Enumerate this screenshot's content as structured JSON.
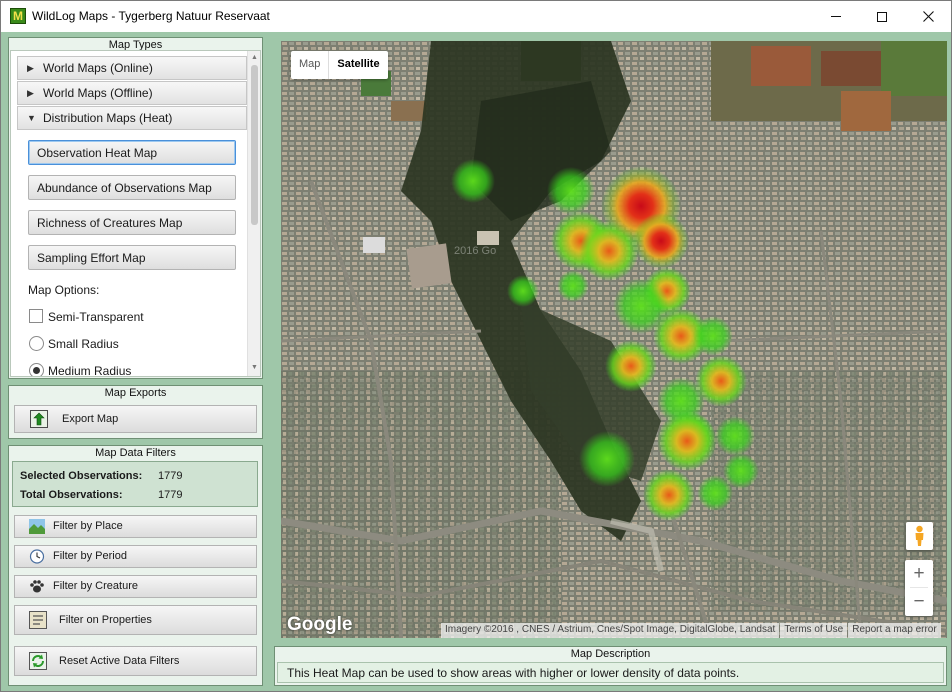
{
  "window": {
    "title": "WildLog Maps - Tygerberg Natuur Reservaat",
    "icon_letter": "M",
    "controls": {
      "minimize": "—",
      "maximize": "☐",
      "close": "✕"
    }
  },
  "map_types": {
    "title": "Map Types",
    "sections": [
      {
        "label": "World Maps (Online)",
        "expanded": false
      },
      {
        "label": "World Maps (Offline)",
        "expanded": false
      },
      {
        "label": "Distribution Maps (Heat)",
        "expanded": true
      }
    ],
    "buttons": [
      {
        "label": "Observation Heat Map",
        "selected": true
      },
      {
        "label": "Abundance of Observations Map"
      },
      {
        "label": "Richness of Creatures Map"
      },
      {
        "label": "Sampling Effort Map"
      }
    ],
    "options_label": "Map Options:",
    "options": [
      {
        "type": "checkbox",
        "label": "Semi-Transparent",
        "checked": false
      },
      {
        "type": "radio",
        "label": "Small Radius",
        "checked": false
      },
      {
        "type": "radio",
        "label": "Medium Radius",
        "checked": true
      }
    ]
  },
  "map_exports": {
    "title": "Map Exports",
    "export_label": "Export Map"
  },
  "filters": {
    "title": "Map Data Filters",
    "selected_label": "Selected Observations:",
    "selected_value": "1779",
    "total_label": "Total Observations:",
    "total_value": "1779",
    "buttons": [
      {
        "label": "Filter by Place",
        "icon": "place-icon"
      },
      {
        "label": "Filter by Period",
        "icon": "clock-icon"
      },
      {
        "label": "Filter by Creature",
        "icon": "paw-icon"
      },
      {
        "label": "Filter on Properties",
        "icon": "properties-icon"
      },
      {
        "label": "Reset Active Data Filters",
        "icon": "reset-icon"
      }
    ]
  },
  "map": {
    "type_tabs": [
      "Map",
      "Satellite"
    ],
    "active_tab": "Satellite",
    "zoom_in": "+",
    "zoom_out": "−",
    "logo": "Google",
    "attribution": "Imagery ©2016 , CNES / Astrium, Cnes/Spot Image, DigitalGlobe, Landsat",
    "terms": "Terms of Use",
    "report": "Report a map error",
    "watermark": "2016 Go"
  },
  "description": {
    "title": "Map Description",
    "text": "This Heat Map can be used to show areas with higher or lower density of data points."
  },
  "colors": {
    "panel_green": "#9fc7a9",
    "heat_low": "#39d51c",
    "heat_mid": "#f0a020",
    "heat_high": "#d8101c"
  }
}
